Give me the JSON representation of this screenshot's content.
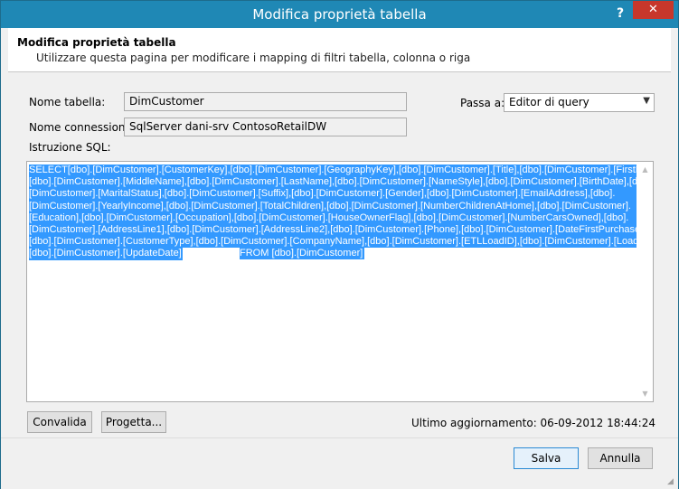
{
  "window": {
    "title": "Modifica proprietà tabella",
    "help_glyph": "?",
    "close_glyph": "✕"
  },
  "header": {
    "title": "Modifica proprietà tabella",
    "subtitle": "Utilizzare questa pagina per modificare i mapping di filtri tabella, colonna o riga"
  },
  "form": {
    "table_name_label": "Nome tabella:",
    "table_name_value": "DimCustomer",
    "connection_label": "Nome connessione:",
    "connection_value": "SqlServer dani-srv ContosoRetailDW",
    "sql_label": "Istruzione SQL:",
    "switch_label": "Passa a:",
    "switch_value": "Editor di query"
  },
  "sql": {
    "lines": [
      "SELECT[dbo].[DimCustomer].[CustomerKey],[dbo].[DimCustomer].[GeographyKey],[dbo].[DimCustomer].[Title],[dbo].[DimCustomer].[FirstName],",
      "[dbo].[DimCustomer].[MiddleName],[dbo].[DimCustomer].[LastName],[dbo].[DimCustomer].[NameStyle],[dbo].[DimCustomer].[BirthDate],[dbo].",
      "[DimCustomer].[MaritalStatus],[dbo].[DimCustomer].[Suffix],[dbo].[DimCustomer].[Gender],[dbo].[DimCustomer].[EmailAddress],[dbo].",
      "[DimCustomer].[YearlyIncome],[dbo].[DimCustomer].[TotalChildren],[dbo].[DimCustomer].[NumberChildrenAtHome],[dbo].[DimCustomer].",
      "[Education],[dbo].[DimCustomer].[Occupation],[dbo].[DimCustomer].[HouseOwnerFlag],[dbo].[DimCustomer].[NumberCarsOwned],[dbo].",
      "[DimCustomer].[AddressLine1],[dbo].[DimCustomer].[AddressLine2],[dbo].[DimCustomer].[Phone],[dbo].[DimCustomer].[DateFirstPurchase],",
      "[dbo].[DimCustomer].[CustomerType],[dbo].[DimCustomer].[CompanyName],[dbo].[DimCustomer].[ETLLoadID],[dbo].[DimCustomer].[LoadDate],",
      "[dbo].[DimCustomer].[UpdateDate]"
    ],
    "from_clause": "FROM [dbo].[DimCustomer]"
  },
  "buttons": {
    "validate": "Convalida",
    "design": "Progetta...",
    "save": "Salva",
    "cancel": "Annulla"
  },
  "status": {
    "last_update": "Ultimo aggiornamento: 06-09-2012 18:44:24"
  },
  "colors": {
    "titlebar": "#1f88b5",
    "selection": "#3399ff",
    "close": "#c7372b"
  }
}
